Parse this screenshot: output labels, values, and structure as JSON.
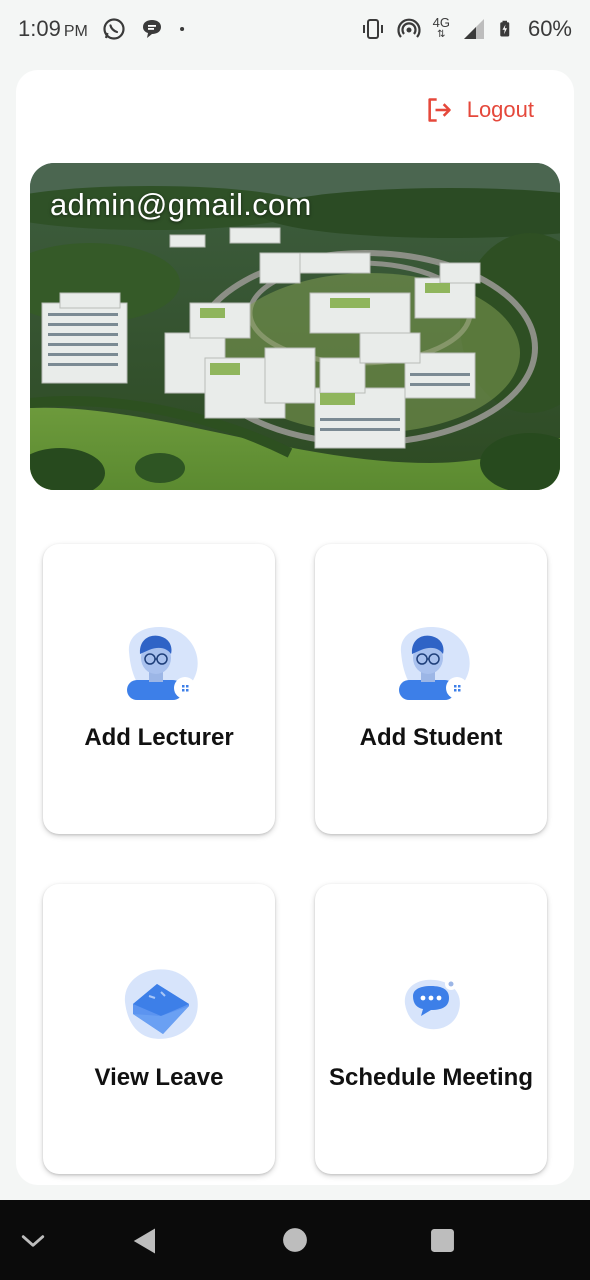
{
  "status_bar": {
    "time": "1:09",
    "ampm": "PM",
    "network": "4G",
    "battery": "60%",
    "icons": [
      "whatsapp-icon",
      "chat-bubble-icon",
      "dot-icon",
      "vibrate-icon",
      "hotspot-icon",
      "signal-icon",
      "battery-icon"
    ]
  },
  "header": {
    "logout_label": "Logout",
    "logout_color": "#e5483b"
  },
  "hero": {
    "email": "admin@gmail.com"
  },
  "tiles": [
    {
      "label": "Add Lecturer",
      "icon": "lecturer-avatar-icon"
    },
    {
      "label": "Add Student",
      "icon": "student-avatar-icon"
    },
    {
      "label": "View Leave",
      "icon": "envelope-icon"
    },
    {
      "label": "Schedule Meeting",
      "icon": "meeting-chat-icon"
    }
  ],
  "nav": {
    "icons": [
      "chevron-down-icon",
      "back-icon",
      "home-icon",
      "recents-icon"
    ]
  },
  "colors": {
    "accent_blue": "#3d7fe8",
    "blob_blue": "#d7e4fb",
    "background": "#f4f6f5"
  }
}
